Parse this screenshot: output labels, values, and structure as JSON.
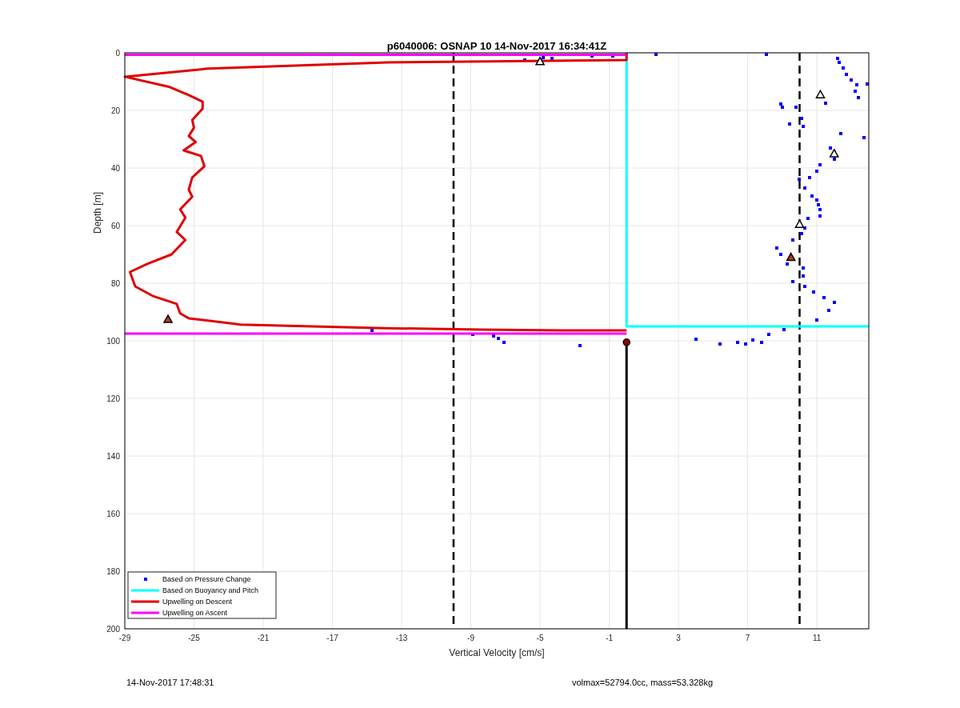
{
  "chart_data": {
    "type": "scatter",
    "title": "p6040006: OSNAP 10 14-Nov-2017 16:34:41Z",
    "xlabel": "Vertical Velocity [cm/s]",
    "ylabel": "Depth [m]",
    "xlim": [
      -29,
      14
    ],
    "ylim": [
      200,
      0
    ],
    "xticks": [
      -29,
      -25,
      -21,
      -17,
      -13,
      -9,
      -5,
      -1,
      3,
      7,
      11
    ],
    "yticks": [
      0,
      20,
      40,
      60,
      80,
      100,
      120,
      140,
      160,
      180,
      200
    ],
    "grid": true,
    "legend": "lower left",
    "series": [
      {
        "name": "Based on Pressure Change",
        "type": "scatter",
        "marker": "square",
        "color": "#0000ff",
        "x": [
          1.7,
          8.1,
          -5.9,
          -4.8,
          -4.3,
          -2.0,
          -0.8,
          12.2,
          12.3,
          12.5,
          12.7,
          13.0,
          13.3,
          13.9,
          13.2,
          13.4,
          11.5,
          8.9,
          9.0,
          9.8,
          10.1,
          9.4,
          10.2,
          12.4,
          13.7,
          11.8,
          12.0,
          12.0,
          11.2,
          11.0,
          10.6,
          10.0,
          10.3,
          10.7,
          11.0,
          11.1,
          11.2,
          11.2,
          10.5,
          10.3,
          10.1,
          9.6,
          8.7,
          8.9,
          9.3,
          10.2,
          10.2,
          9.6,
          10.3,
          10.8,
          11.4,
          12.0,
          11.7,
          11.0,
          10.5,
          9.1,
          8.2,
          7.3,
          6.4,
          5.4,
          4.0,
          6.9,
          7.8,
          -14.7,
          -8.9,
          -7.7,
          -7.4,
          -7.1,
          -2.7
        ],
        "values": [
          0.6,
          0.6,
          2.5,
          1.7,
          1.9,
          1.1,
          1.1,
          2,
          3.3,
          5.3,
          7.5,
          9.4,
          11,
          10.8,
          13.3,
          15.5,
          17.5,
          17.8,
          19,
          19,
          22.8,
          24.7,
          25.5,
          28,
          29.4,
          33,
          34.4,
          37,
          38.9,
          41,
          43.3,
          44,
          47,
          49.7,
          51,
          52.8,
          54.4,
          56.7,
          57.5,
          60.8,
          62.8,
          65,
          67.8,
          70,
          73.3,
          74.7,
          77.5,
          79.4,
          81,
          83,
          85,
          86.7,
          89.4,
          92.8,
          null,
          96,
          97.8,
          99.7,
          100.5,
          101,
          99.4,
          101,
          100.5,
          96.4,
          97.8,
          98.3,
          99.2,
          100.5,
          101.7
        ]
      },
      {
        "name": "Based on Buoyancy and Pitch",
        "type": "line",
        "color": "#00ffff",
        "x": [
          0,
          0,
          14
        ],
        "values": [
          0,
          95,
          95
        ]
      },
      {
        "name": "Upwelling on Descent",
        "type": "line",
        "color": "#e00000",
        "x": [
          0,
          0,
          -13.8,
          -24.2,
          -29,
          -26.4,
          -25.3,
          -24.5,
          -24.5,
          -25.1,
          -25,
          -25.3,
          -24.9,
          -25.6,
          -24.6,
          -24.4,
          -25.1,
          -25.3,
          -25.1,
          -25.8,
          -25.5,
          -26,
          -25.5,
          -26.3,
          -27.7,
          -28.7,
          -28.4,
          -27.4,
          -26,
          -25.8,
          -25.3,
          -22.3,
          -14,
          -8.4,
          -3.8,
          0
        ],
        "values": [
          0,
          2.5,
          3.3,
          5.5,
          8.3,
          11.9,
          14.7,
          17,
          19.4,
          23.3,
          26,
          28.9,
          31,
          33.9,
          35.8,
          39.4,
          43.3,
          47.5,
          50,
          54.4,
          57.2,
          62.2,
          65,
          70,
          73.3,
          76.1,
          81.1,
          84.4,
          87.2,
          90.5,
          92.2,
          94.4,
          95.6,
          96.1,
          96.4,
          96.4
        ]
      },
      {
        "name": "Upwelling on Ascent",
        "type": "line",
        "color": "#ff00ff",
        "x": [
          -29,
          0
        ],
        "values": [
          97.5,
          97.5
        ]
      },
      {
        "type": "line",
        "color": "#ff00ff",
        "x": [
          -29,
          0
        ],
        "values": [
          0.7,
          0.7
        ]
      },
      {
        "type": "line",
        "color": "#000000",
        "x": [
          0,
          0
        ],
        "values": [
          101,
          200
        ]
      },
      {
        "type": "scatter",
        "marker": "triangle",
        "color": "#c0392b",
        "x": [
          -26.5,
          9.5
        ],
        "values": [
          92.5,
          71
        ]
      },
      {
        "type": "scatter",
        "marker": "triangle",
        "color": "#ffffff",
        "x": [
          -5,
          11.2,
          12,
          10
        ],
        "values": [
          3,
          14.5,
          35,
          59.5
        ]
      },
      {
        "type": "scatter",
        "marker": "circle",
        "color": "#a00000",
        "x": [
          0
        ],
        "values": [
          100.5
        ]
      }
    ],
    "ref_lines": [
      {
        "axis": "x",
        "value": -10
      },
      {
        "axis": "x",
        "value": 10
      }
    ]
  },
  "footer": {
    "timestamp": "14-Nov-2017 17:48:31",
    "note": "volmax=52794.0cc, mass=53.328kg"
  }
}
